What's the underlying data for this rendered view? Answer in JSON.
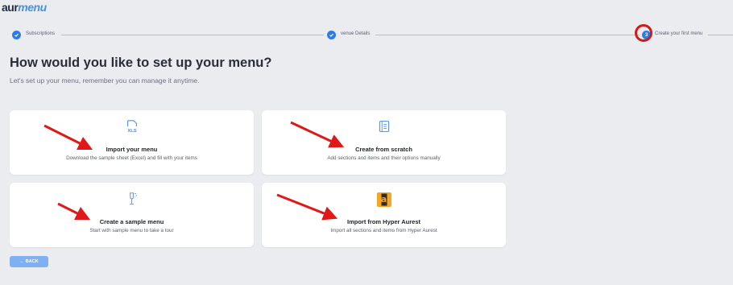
{
  "logo": {
    "part1": "aur",
    "part2": "menu"
  },
  "stepper": {
    "steps": [
      {
        "label": "Subscriptions",
        "state": "done"
      },
      {
        "label": "venue Details",
        "state": "done"
      },
      {
        "label": "Create your first menu",
        "state": "current",
        "number": "3"
      }
    ]
  },
  "header": {
    "title": "How would you like to set up your menu?",
    "subtitle": "Let's set up your menu, remember you can manage it anytime."
  },
  "options": [
    {
      "title": "Import your menu",
      "description": "Download the sample sheet (Excel) and fill with your items",
      "icon": "xls-file-icon"
    },
    {
      "title": "Create from scratch",
      "description": "Add sections and items and their options manually",
      "icon": "notebook-icon"
    },
    {
      "title": "Create a sample menu",
      "description": "Start with sample menu to take a tour",
      "icon": "champagne-glass-icon"
    },
    {
      "title": "Import from Hyper Aurest",
      "description": "Import all sections and items from Hyper Aurest",
      "icon": "hyper-aurest-logo-icon",
      "icon_text": "a"
    }
  ],
  "back_button": {
    "label": "BACK"
  },
  "colors": {
    "accent": "#2d7be5",
    "annotation": "#d11b1b",
    "back": "#7fb0f2",
    "background": "#ebecf0"
  }
}
